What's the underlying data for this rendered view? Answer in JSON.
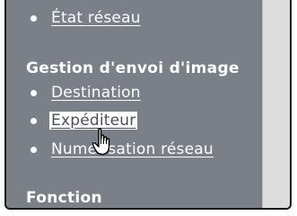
{
  "menu": {
    "items_top": [
      {
        "label": "État réseau"
      }
    ],
    "sections": [
      {
        "heading": "Gestion d'envoi d'image",
        "items": [
          {
            "label": "Destination"
          },
          {
            "label": "Expéditeur",
            "highlighted": true
          },
          {
            "label": "Numérisation réseau"
          }
        ]
      },
      {
        "heading": "Fonction",
        "items": []
      }
    ]
  },
  "icons": {
    "cursor": "hand-pointer-icon"
  }
}
